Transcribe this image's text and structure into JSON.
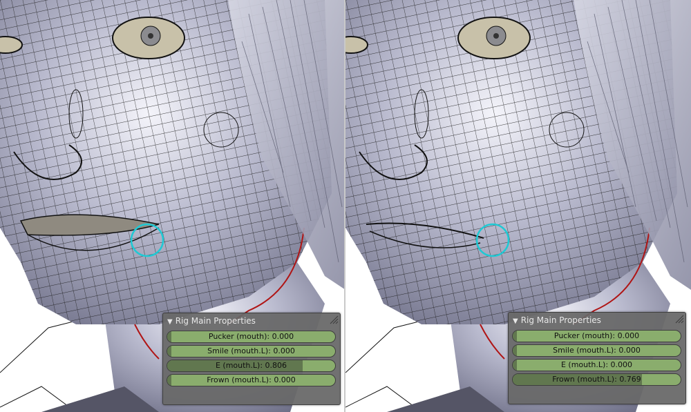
{
  "panels": [
    {
      "title": "Rig Main Properties",
      "sliders": [
        {
          "label": "Pucker (mouth)",
          "value": "0.000",
          "fraction": 0.0
        },
        {
          "label": "Smile (mouth.L)",
          "value": "0.000",
          "fraction": 0.0
        },
        {
          "label": "E (mouth.L)",
          "value": "0.806",
          "fraction": 0.806
        },
        {
          "label": "Frown (mouth.L)",
          "value": "0.000",
          "fraction": 0.0
        }
      ]
    },
    {
      "title": "Rig Main Properties",
      "sliders": [
        {
          "label": "Pucker (mouth)",
          "value": "0.000",
          "fraction": 0.0
        },
        {
          "label": "Smile (mouth.L)",
          "value": "0.000",
          "fraction": 0.0
        },
        {
          "label": "E (mouth.L)",
          "value": "0.000",
          "fraction": 0.0
        },
        {
          "label": "Frown (mouth.L)",
          "value": "0.769",
          "fraction": 0.769
        }
      ]
    }
  ],
  "colors": {
    "mesh": "#a7a8c0",
    "wire": "#1b1b1b",
    "selected_bone": "#1fc9d4",
    "spine_curve": "#b01515",
    "slider_fill": "#8aad6d",
    "slider_value": "#61774f"
  }
}
